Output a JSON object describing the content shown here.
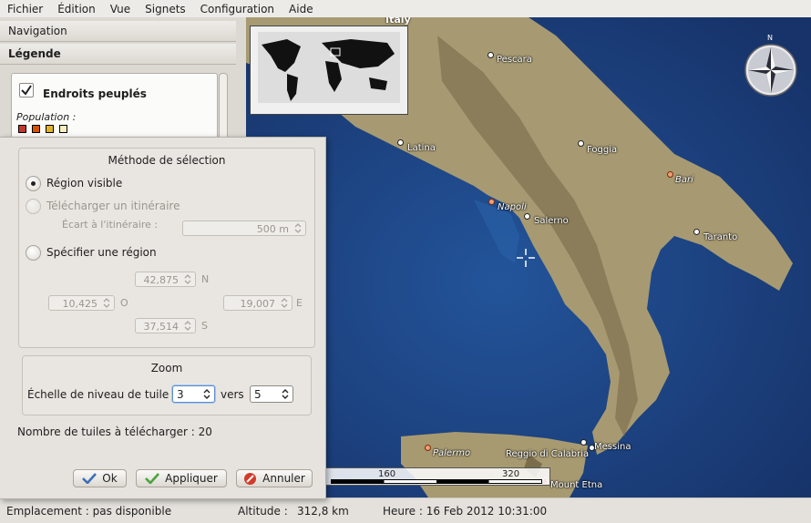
{
  "menu": [
    "Fichier",
    "Édition",
    "Vue",
    "Signets",
    "Configuration",
    "Aide"
  ],
  "sidebar": {
    "tabs": [
      "Navigation",
      "Légende"
    ],
    "legend": {
      "item_label": "Endroits peuplés",
      "item_checked": true,
      "population_label": "Population :"
    }
  },
  "dialog": {
    "method_group": {
      "title": "Méthode de sélection",
      "options": [
        {
          "label": "Région visible",
          "checked": true,
          "enabled": true
        },
        {
          "label": "Télécharger un itinéraire",
          "checked": false,
          "enabled": false
        },
        {
          "label": "Spécifier une région",
          "checked": false,
          "enabled": true
        }
      ],
      "route_distance_label": "Écart à l'itinéraire :",
      "route_distance_value": "500 m",
      "region": {
        "north": "42,875",
        "north_label": "N",
        "west": "10,425",
        "west_label": "O",
        "east": "19,007",
        "east_label": "E",
        "south": "37,514",
        "south_label": "S"
      }
    },
    "zoom_group": {
      "title": "Zoom",
      "scale_label": "Échelle de niveau de tuile :",
      "from_value": "3",
      "to_label": "vers",
      "to_value": "5"
    },
    "tiles_count": "Nombre de tuiles à télécharger : 20",
    "buttons": {
      "ok": "Ok",
      "apply": "Appliquer",
      "cancel": "Annuler"
    }
  },
  "map": {
    "overview_label": "Italy",
    "compass_label": "N",
    "scale_labels": [
      "160",
      "320"
    ],
    "cities": [
      {
        "name": "Pescara",
        "italic": false
      },
      {
        "name": "Latina",
        "italic": false
      },
      {
        "name": "Foggia",
        "italic": false
      },
      {
        "name": "Bari",
        "italic": true
      },
      {
        "name": "Napoli",
        "italic": true
      },
      {
        "name": "Salerno",
        "italic": false
      },
      {
        "name": "Taranto",
        "italic": false
      },
      {
        "name": "Palermo",
        "italic": true
      },
      {
        "name": "Reggio di Calabria",
        "italic": false
      },
      {
        "name": "Messina",
        "italic": false
      },
      {
        "name": "Mount Etna",
        "italic": false
      }
    ]
  },
  "statusbar": {
    "location": "Emplacement : pas disponible",
    "altitude_label": "Altitude :",
    "altitude_value": "312,8 km",
    "time": "Heure : 16 Feb 2012 10:31:00"
  },
  "colors": {
    "sea": "#1c3f78",
    "land": "#a79a72",
    "panel": "#dcd9d3",
    "focus": "#5d8fcf"
  }
}
